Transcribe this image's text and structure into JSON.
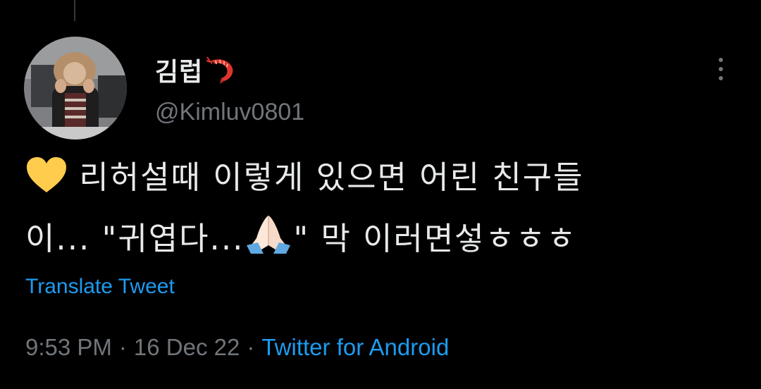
{
  "tweet": {
    "author": {
      "display_name": "김럽",
      "name_emoji": "shrimp-icon",
      "handle": "@Kimluv0801"
    },
    "text_line1": "리허설때 이렇게 있으면 어린 친구들",
    "text_line2_a": "이... \"귀엽다...",
    "text_line2_b": "\" 막 이러면섷ㅎㅎㅎ",
    "emojis": [
      "yellow-heart-icon",
      "folded-hands-icon"
    ],
    "translate_label": "Translate Tweet",
    "time": "9:53 PM",
    "date": "16 Dec 22",
    "separator": "·",
    "source": "Twitter for Android"
  },
  "colors": {
    "background": "#000000",
    "text": "#e7e9ea",
    "secondary": "#71767b",
    "link": "#1d9bf0",
    "heart": "#ffcc4d"
  }
}
